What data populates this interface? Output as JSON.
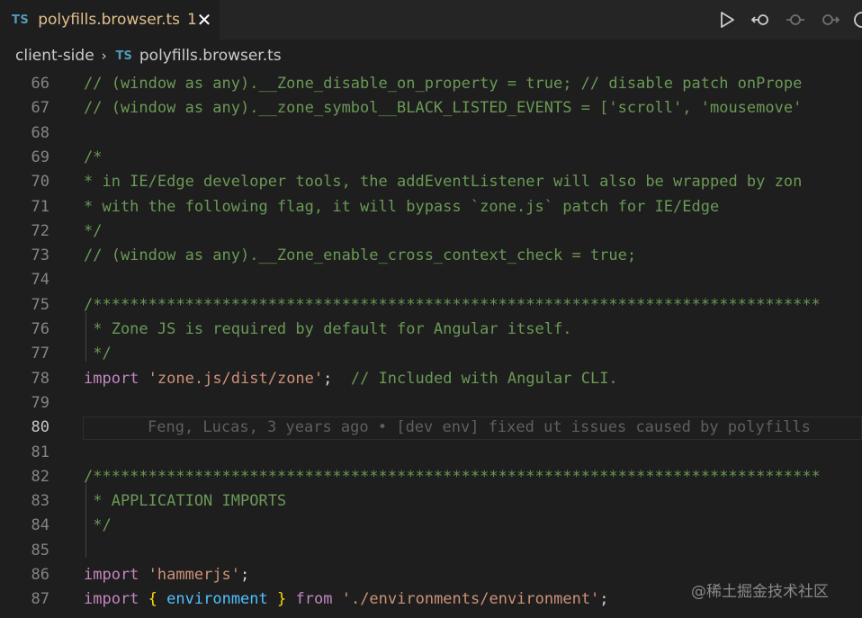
{
  "tab": {
    "lang_badge": "TS",
    "filename": "polyfills.browser.ts",
    "problem_count": "1",
    "close_glyph": "✕"
  },
  "toolbar": {
    "icons": [
      "run-icon",
      "go-back-icon",
      "commit-icon",
      "go-forward-icon",
      "more-icon"
    ]
  },
  "breadcrumb": {
    "folder": "client-side",
    "separator": "›",
    "file_badge": "TS",
    "file": "polyfills.browser.ts"
  },
  "editor": {
    "active_line": "80",
    "lines": [
      {
        "num": "66",
        "text": "// (window as any).__Zone_disable_on_property = true; // disable patch onPrope"
      },
      {
        "num": "67",
        "text": "// (window as any).__zone_symbol__BLACK_LISTED_EVENTS = ['scroll', 'mousemove'"
      },
      {
        "num": "68",
        "text": ""
      },
      {
        "num": "69",
        "text": "/*"
      },
      {
        "num": "70",
        "text": "* in IE/Edge developer tools, the addEventListener will also be wrapped by zon"
      },
      {
        "num": "71",
        "text": "* with the following flag, it will bypass `zone.js` patch for IE/Edge"
      },
      {
        "num": "72",
        "text": "*/"
      },
      {
        "num": "73",
        "text": "// (window as any).__Zone_enable_cross_context_check = true;"
      },
      {
        "num": "74",
        "text": ""
      },
      {
        "num": "75",
        "text": "/*******************************************************************************"
      },
      {
        "num": "76",
        "text": " * Zone JS is required by default for Angular itself."
      },
      {
        "num": "77",
        "text": " */"
      },
      {
        "num": "78",
        "kw": "import",
        "str": "'zone.js/dist/zone'",
        "rest": ";  ",
        "comment": "// Included with Angular CLI."
      },
      {
        "num": "79",
        "text": ""
      },
      {
        "num": "80",
        "blame": "Feng, Lucas, 3 years ago • [dev env] fixed ut issues caused by polyfills"
      },
      {
        "num": "81",
        "text": ""
      },
      {
        "num": "82",
        "text": "/*******************************************************************************"
      },
      {
        "num": "83",
        "text": " * APPLICATION IMPORTS"
      },
      {
        "num": "84",
        "text": " */"
      },
      {
        "num": "85",
        "text": ""
      },
      {
        "num": "86",
        "kw": "import",
        "str": "'hammerjs'",
        "rest": ";"
      },
      {
        "num": "87",
        "kw": "import",
        "brace_open": "{",
        "var": "environment",
        "brace_close": "}",
        "kw2": "from",
        "str": "'./environments/environment'",
        "rest": ";"
      }
    ]
  },
  "watermark": "@稀土掘金技术社区"
}
